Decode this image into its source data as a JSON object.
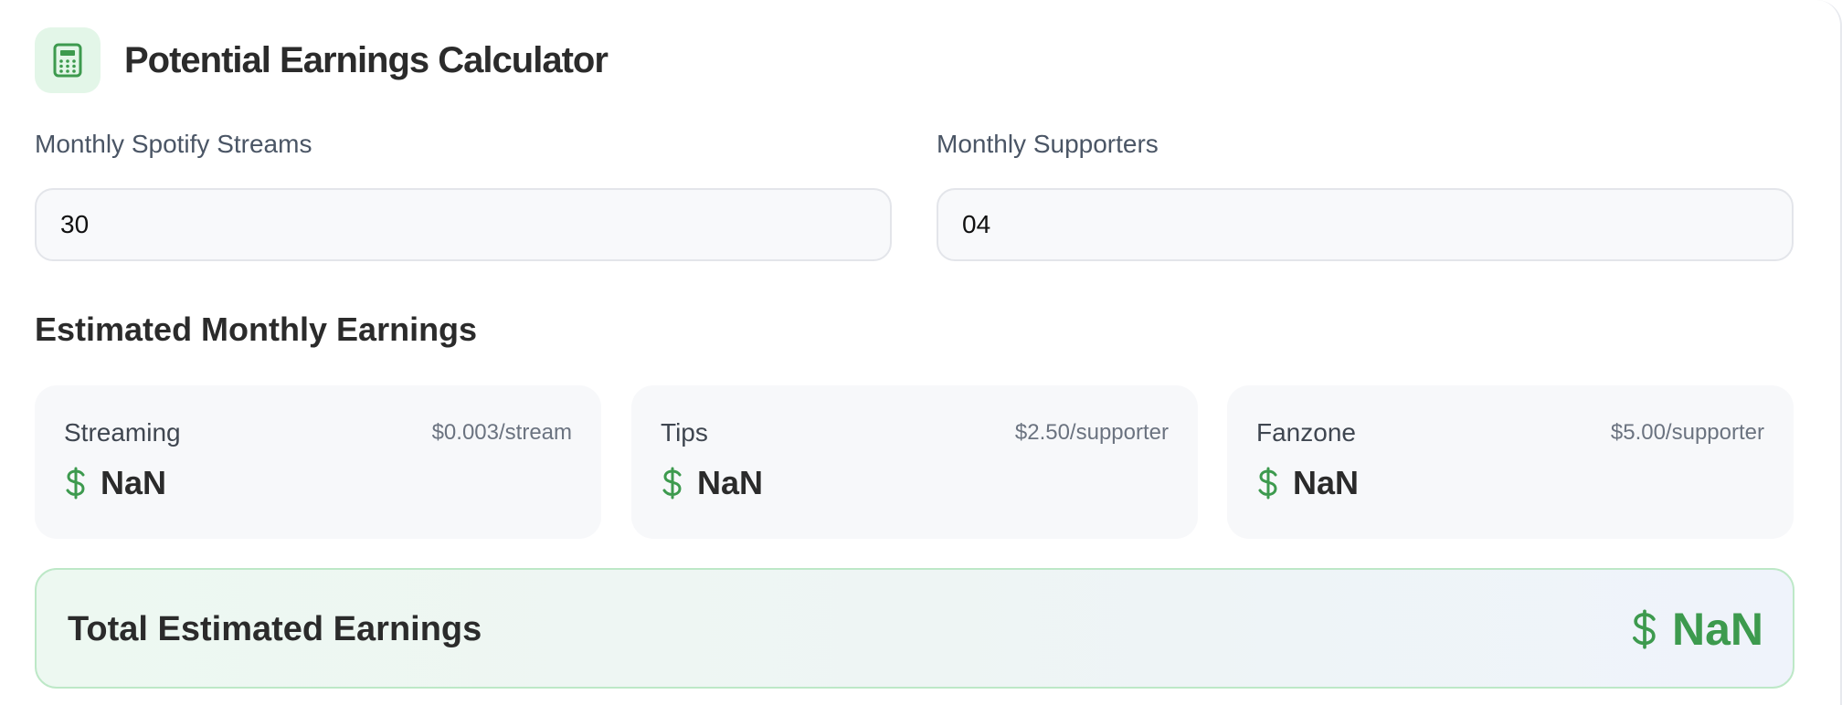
{
  "header": {
    "title": "Potential Earnings Calculator",
    "icon": "calculator-icon"
  },
  "inputs": {
    "streams": {
      "label": "Monthly Spotify Streams",
      "value": "30"
    },
    "supporters": {
      "label": "Monthly Supporters",
      "value": "04"
    }
  },
  "estimates": {
    "title": "Estimated Monthly Earnings",
    "cards": [
      {
        "name": "Streaming",
        "rate": "$0.003/stream",
        "value": "NaN"
      },
      {
        "name": "Tips",
        "rate": "$2.50/supporter",
        "value": "NaN"
      },
      {
        "name": "Fanzone",
        "rate": "$5.00/supporter",
        "value": "NaN"
      }
    ]
  },
  "total": {
    "label": "Total Estimated Earnings",
    "value": "NaN"
  },
  "colors": {
    "accent_green": "#3d9a4e",
    "icon_bg": "#e3f6e8",
    "total_border": "#bde8c7"
  }
}
